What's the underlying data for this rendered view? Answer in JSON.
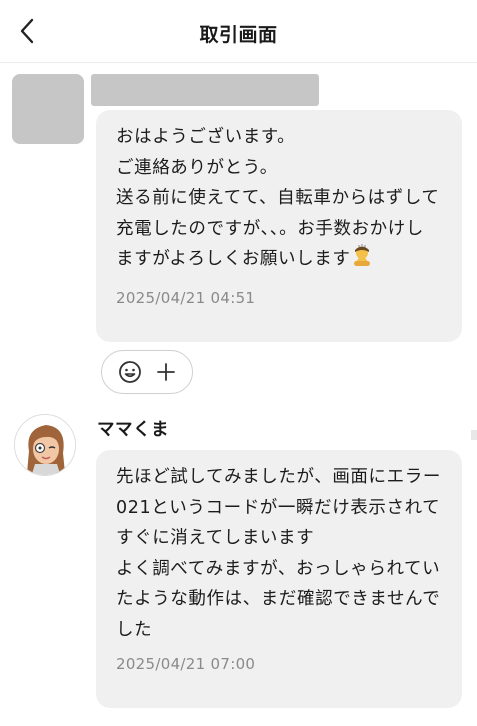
{
  "header": {
    "title": "取引画面",
    "back_icon": "chevron-left-icon"
  },
  "messages": [
    {
      "sender_name": "",
      "text": "おはようございます。\nご連絡ありがとう。\n送る前に使えてて、自転車からはずして充電したのですが、、。お手数おかけしますがよろしくお願いします",
      "trailing_emoji": "bowing-person-icon",
      "timestamp": "2025/04/21 04:51"
    },
    {
      "sender_name": "ママくま",
      "text": "先ほど試してみましたが、画面にエラー021というコードが一瞬だけ表示されてすぐに消えてしまいます\nよく調べてみますが、おっしゃられていたような動作は、まだ確認できませんでした",
      "timestamp": "2025/04/21 07:00"
    }
  ],
  "reaction": {
    "emoji_icon": "smiley-icon",
    "add_icon": "plus-icon"
  },
  "colors": {
    "bubble_bg": "#f0f0f0",
    "placeholder": "#c6c6c6",
    "timestamp": "#8a8a8a"
  }
}
